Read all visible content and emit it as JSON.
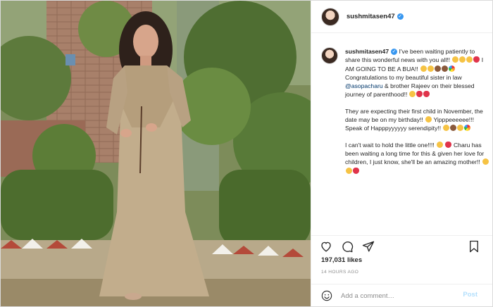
{
  "post": {
    "username": "sushmitasen47",
    "caption": {
      "p1_a": "I've been waiting patiently to share this wonderful news with you all!! ",
      "p1_b": " I AM GOING TO BE A BUA!! ",
      "p1_c": "Congratulations to my beautiful sister in law ",
      "mention": "@asopacharu",
      "p1_d": " & brother Rajeev on their blessed journey of parenthood!! ",
      "p2_a": "They are expecting their first child in November, the date may be on my birthday!! ",
      "p2_b": " Yipppeeeeee!!! Speak of Happpyyyyyy serendipity!! ",
      "p3_a": "I can't wait to hold the little one!!!! ",
      "p3_b": " Charu has been waiting a long time for this & given her love for children, I just know, she'll be an amazing mother!! "
    },
    "likes": "197,031 likes",
    "time": "14 HOURS AGO",
    "comment_placeholder": "Add a comment…",
    "post_label": "Post"
  },
  "icons": [
    "heart-icon",
    "comment-icon",
    "share-icon",
    "bookmark-icon",
    "emoji-icon",
    "verified-icon"
  ],
  "colors": {
    "link": "#00376b",
    "verified": "#3897f0",
    "post_button": "#b2dffc",
    "muted": "#8e8e8e"
  }
}
